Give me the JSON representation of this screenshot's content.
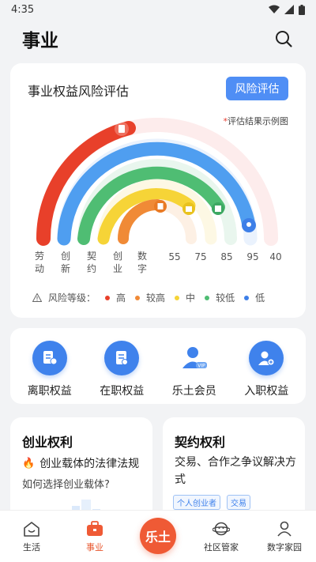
{
  "status_bar": {
    "time": "4:35"
  },
  "header": {
    "title": "事业"
  },
  "risk_card": {
    "title": "事业权益风险评估",
    "assess_button": "风险评估",
    "example_note_star": "*",
    "example_note": "评估结果示例图",
    "industries": [
      "劳动",
      "创新",
      "契约",
      "创业",
      "数字"
    ],
    "scores": [
      "55",
      "75",
      "85",
      "95",
      "40"
    ],
    "legend_title": "风险等级：",
    "legend": [
      {
        "label": "高",
        "color": "#e8402a"
      },
      {
        "label": "较高",
        "color": "#f08a36"
      },
      {
        "label": "中",
        "color": "#f6d437"
      },
      {
        "label": "较低",
        "color": "#4fbd73"
      },
      {
        "label": "低",
        "color": "#3d7fe8"
      }
    ],
    "ring_colors": [
      "#e8402a",
      "#4f9ef0",
      "#4fbd73",
      "#f6d437",
      "#f08a36"
    ]
  },
  "rights": [
    {
      "label": "离职权益",
      "icon": "resignation-doc-icon"
    },
    {
      "label": "在职权益",
      "icon": "employment-doc-icon"
    },
    {
      "label": "乐土会员",
      "icon": "vip-member-icon"
    },
    {
      "label": "入职权益",
      "icon": "onboarding-user-icon"
    }
  ],
  "startup_card": {
    "title": "创业权利",
    "hot_item": "创业载体的法律法规",
    "sub_item": "如何选择创业载体?"
  },
  "contract_card": {
    "title": "契约权利",
    "desc": "交易、合作之争议解决方式",
    "tags": [
      "个人创业者",
      "交易"
    ]
  },
  "tab_bar": {
    "tabs": [
      {
        "label": "生活"
      },
      {
        "label": "事业"
      },
      {
        "label": "社区管家"
      },
      {
        "label": "数字家园"
      }
    ],
    "center_label": "乐土"
  }
}
